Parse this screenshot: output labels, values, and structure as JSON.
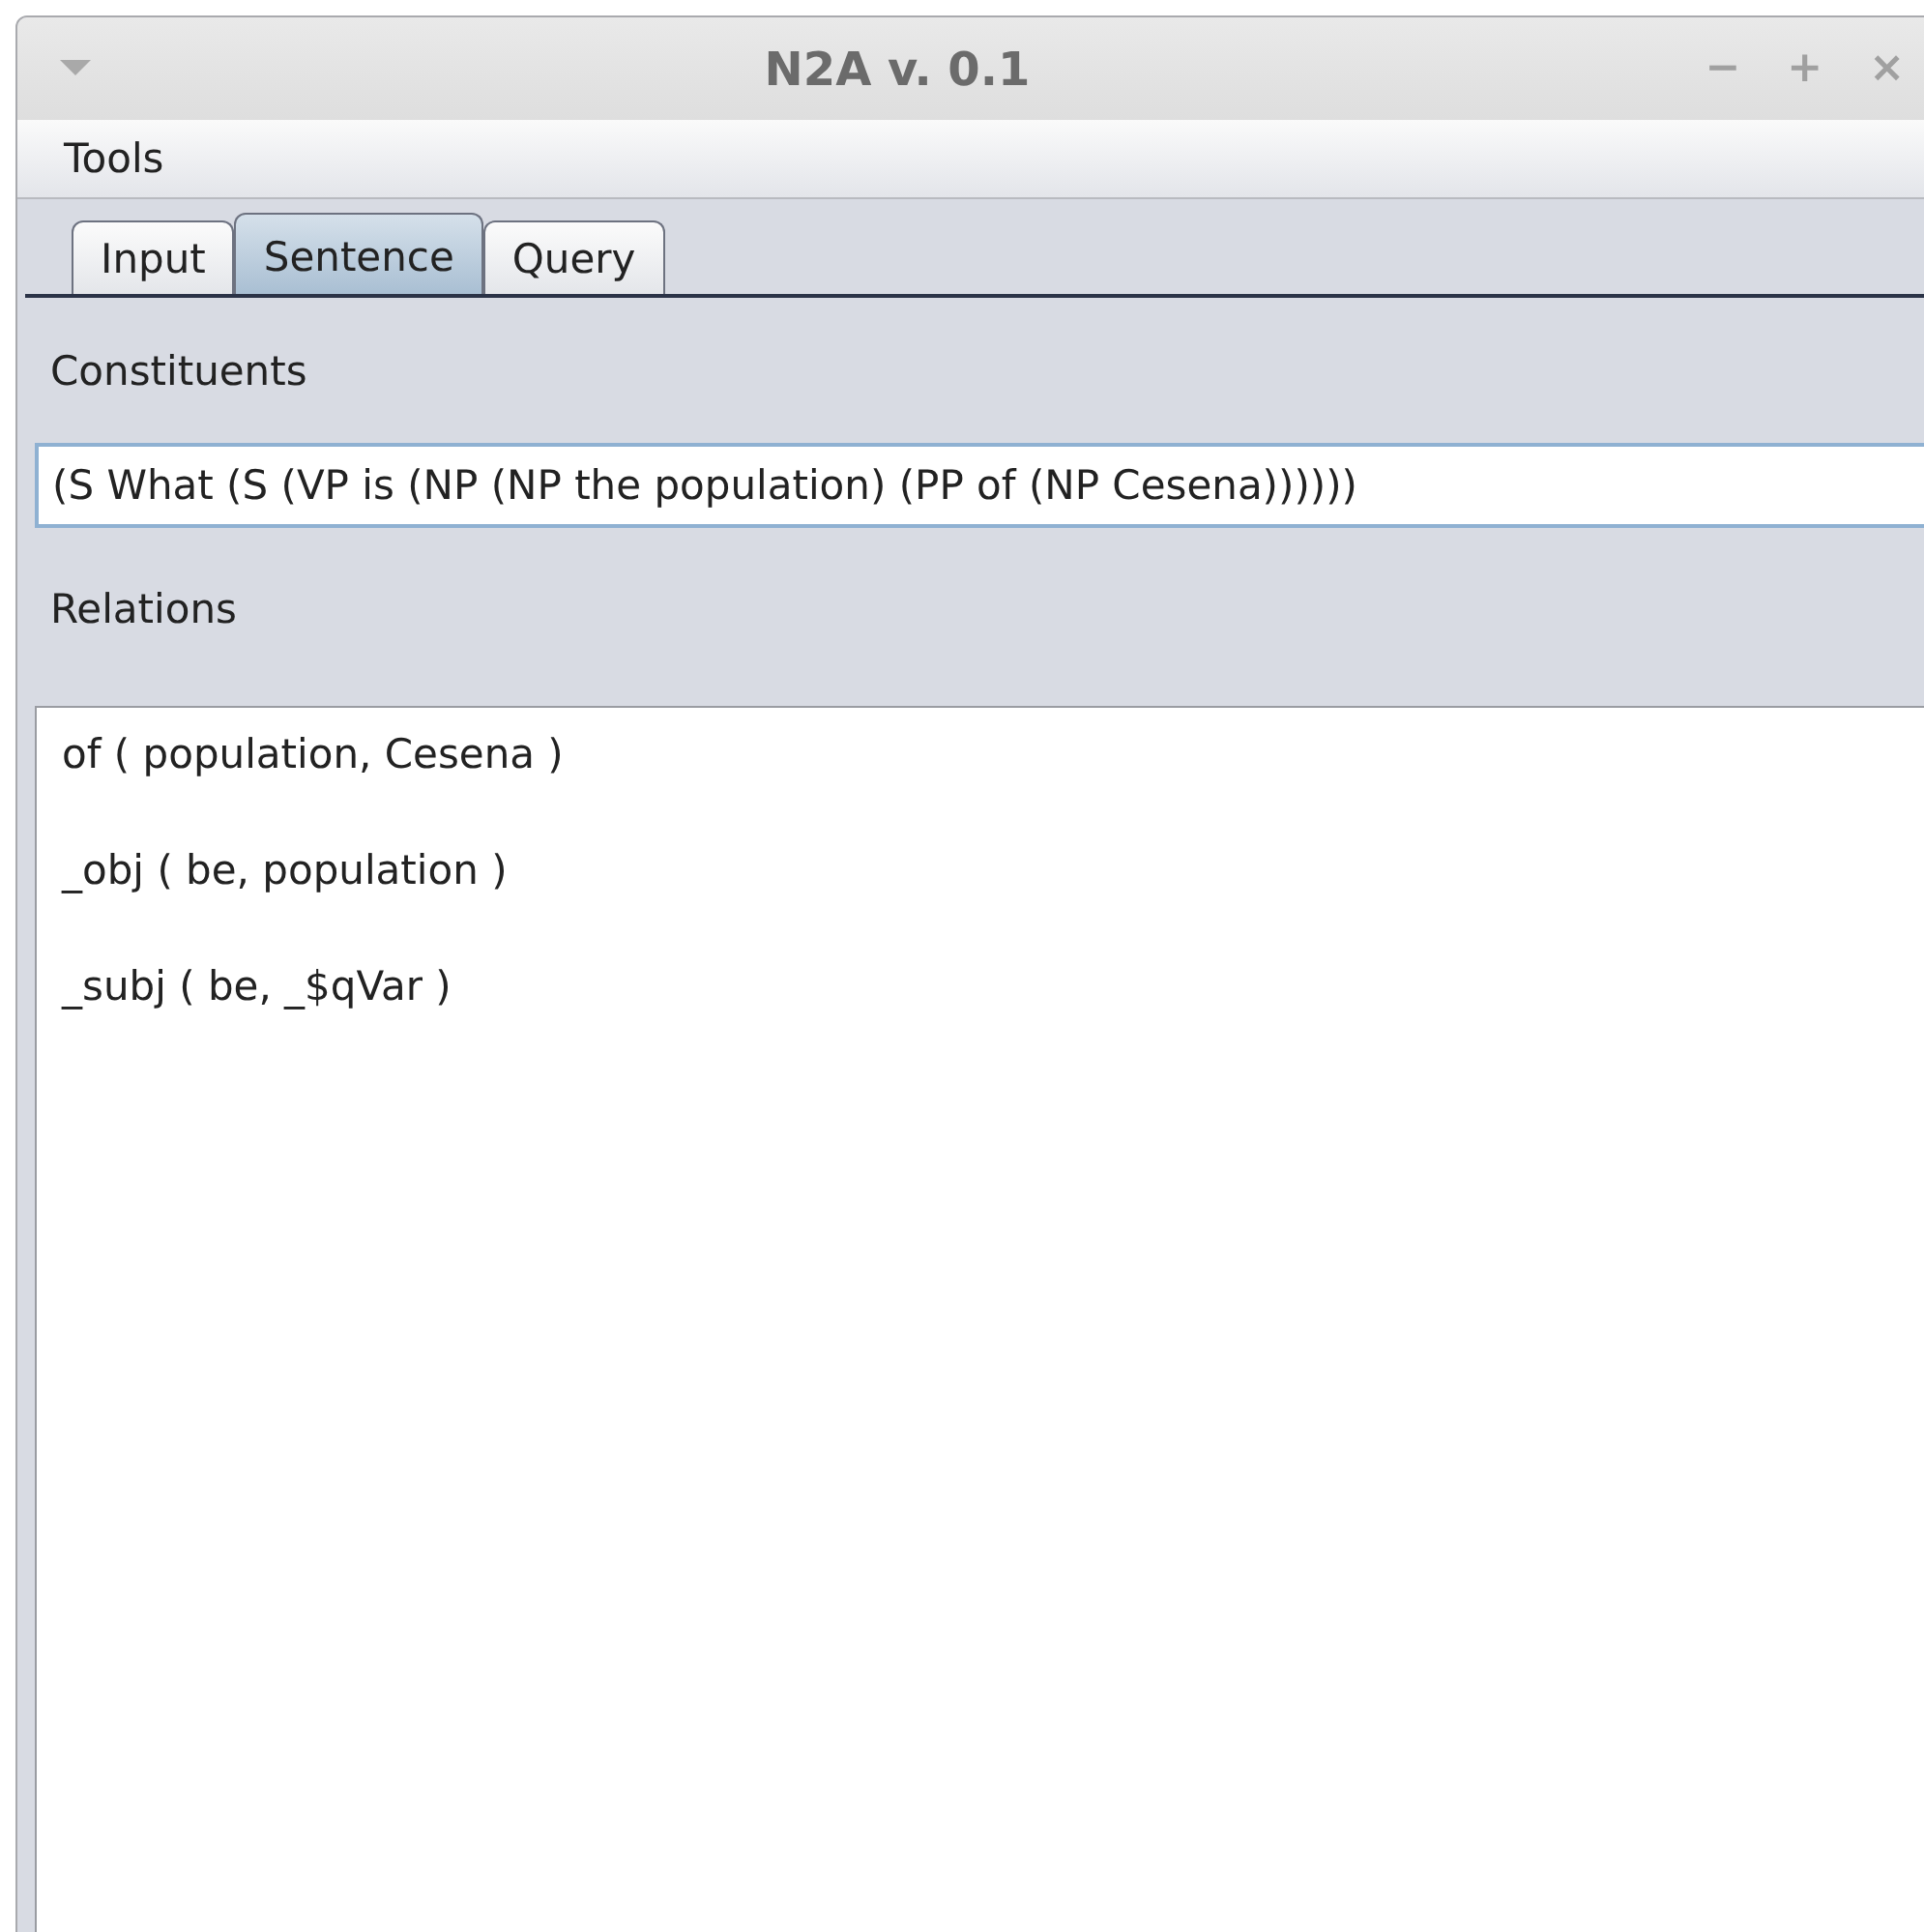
{
  "window": {
    "title": "N2A v. 0.1",
    "controls": [
      "−",
      "+",
      "×"
    ]
  },
  "menu": [
    "Tools"
  ],
  "tabs": [
    {
      "label": "Input",
      "selected": false
    },
    {
      "label": "Sentence",
      "selected": true
    },
    {
      "label": "Query",
      "selected": false
    }
  ],
  "constituents": {
    "label": "Constituents",
    "value": "(S What (S (VP is (NP (NP the population) (PP of (NP Cesena))))))"
  },
  "relations": {
    "label": "Relations",
    "lines": [
      "of ( population, Cesena )",
      "_obj ( be, population )",
      "_subj ( be, _$qVar )"
    ]
  }
}
